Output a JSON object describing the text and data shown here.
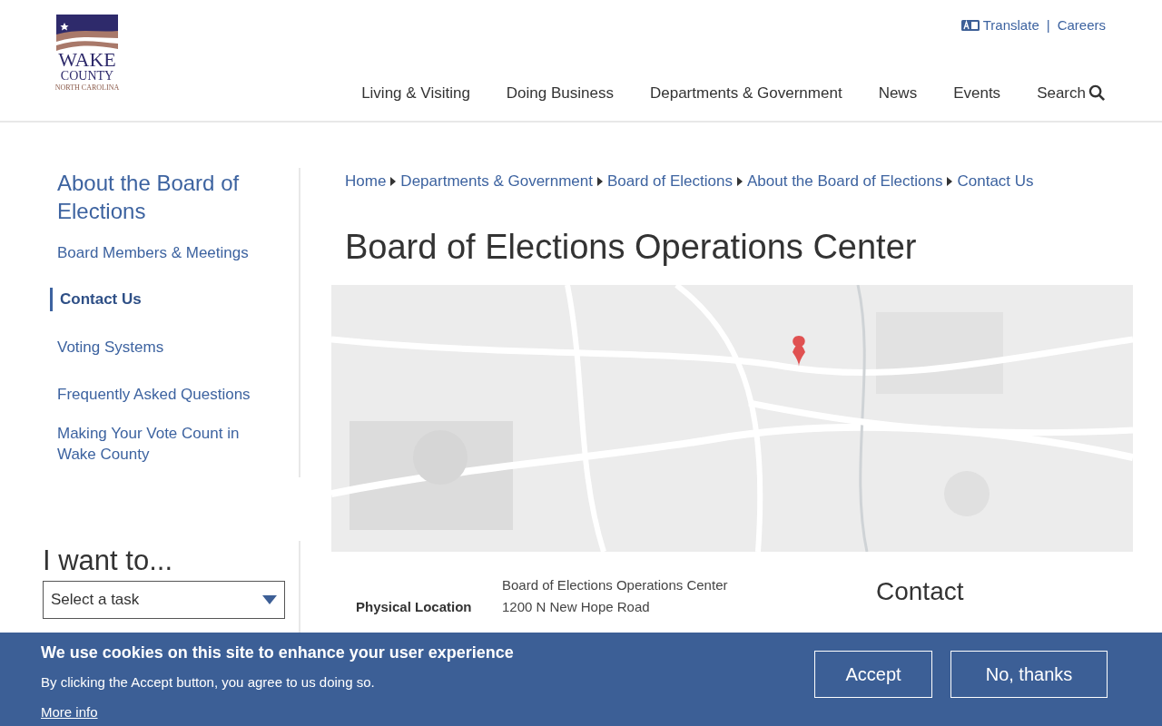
{
  "logo": {
    "line1": "WAKE",
    "line2": "COUNTY",
    "line3": "NORTH CAROLINA"
  },
  "utility_links": [
    {
      "label": "Translate",
      "kind": "translate"
    },
    {
      "label": "Careers",
      "kind": "plain"
    }
  ],
  "utility_separator": "|",
  "nav": [
    {
      "label": "Living & Visiting",
      "kind": "link"
    },
    {
      "label": "Doing Business",
      "kind": "link"
    },
    {
      "label": "Departments & Government",
      "kind": "link"
    },
    {
      "label": "News",
      "kind": "link"
    },
    {
      "label": "Events",
      "kind": "link"
    },
    {
      "label": "Search",
      "kind": "search"
    }
  ],
  "sidebar": {
    "title": "About the Board of Elections",
    "items": [
      {
        "label": "Board Members & Meetings",
        "selected": false
      },
      {
        "label": "Contact Us",
        "selected": true
      },
      {
        "label": "Voting Systems",
        "selected": false
      },
      {
        "label": "Frequently Asked Questions",
        "selected": false
      },
      {
        "label": "Making Your Vote Count in Wake County",
        "selected": false
      }
    ]
  },
  "i_want_to": {
    "title": "I want to...",
    "select": "Select a task"
  },
  "breadcrumbs": [
    "Home",
    "Departments & Government",
    "Board of Elections",
    "About the Board of Elections",
    "Contact Us"
  ],
  "page_title": "Board of Elections Operations Center",
  "map": {
    "kind": "picture"
  },
  "location": {
    "label": "Physical Location",
    "lines": [
      "Board of Elections Operations Center",
      "1200 N New Hope Road"
    ]
  },
  "contact_heading": "Contact",
  "cookie_banner": {
    "title": "We use cookies on this site to enhance your user experience",
    "text": "By clicking the Accept button, you agree to us doing so.",
    "link": "More info",
    "buttons": [
      "Accept",
      "No, thanks"
    ]
  }
}
